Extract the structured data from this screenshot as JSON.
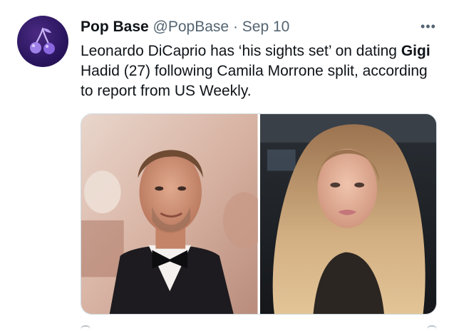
{
  "tweet": {
    "display_name": "Pop Base",
    "handle": "@PopBase",
    "separator": "·",
    "date": "Sep 10",
    "more_label": "•••",
    "text_part1": "Leonardo DiCaprio has ‘his sights set’ on dating ",
    "text_bold": "Gigi",
    "text_part2": " Hadid (27) following Camila Morrone split, according to report from US Weekly."
  },
  "icons": {
    "avatar": "cherry-icon",
    "more": "more-options-icon"
  },
  "colors": {
    "avatar_bg": "#2b1660",
    "secondary_text": "#536471",
    "primary_text": "#0f1419",
    "border": "#cfd9de"
  }
}
